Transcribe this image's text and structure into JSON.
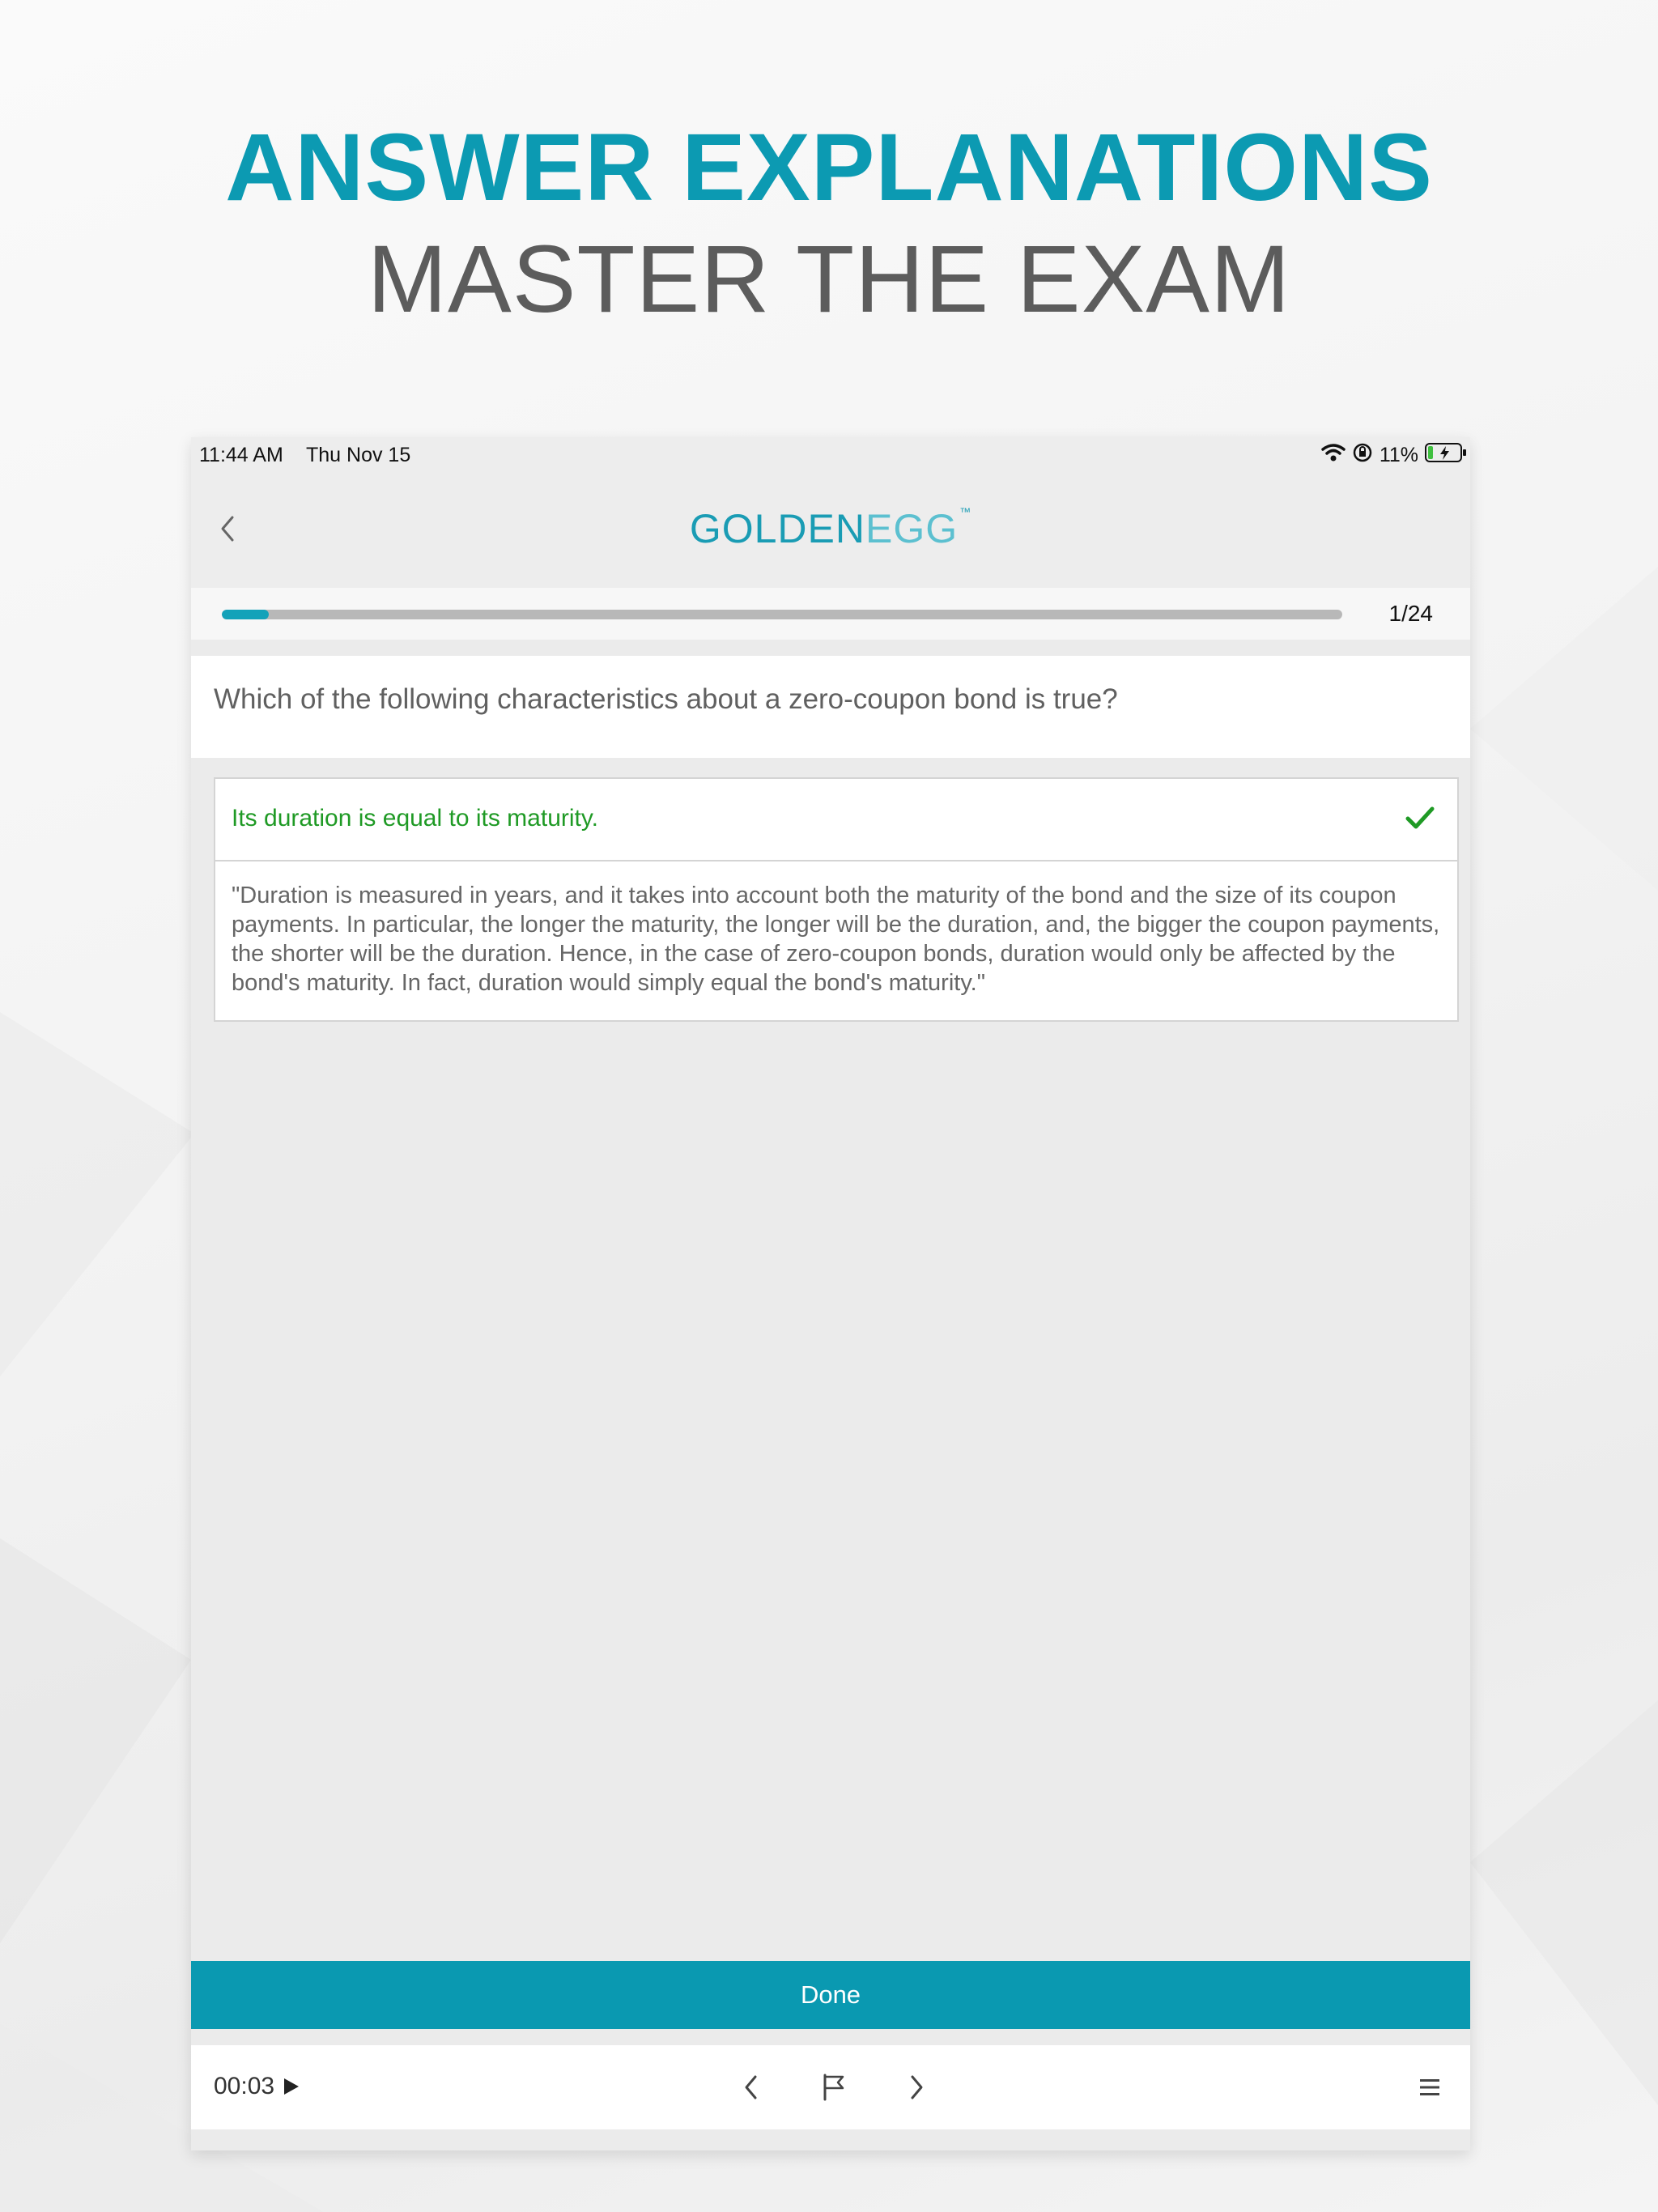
{
  "promo": {
    "headline": "ANSWER EXPLANATIONS",
    "subheadline": "MASTER THE EXAM"
  },
  "status_bar": {
    "time": "11:44 AM",
    "date": "Thu Nov 15",
    "battery_percent": "11%",
    "icons": [
      "wifi-icon",
      "orientation-lock-icon",
      "battery-charging-icon"
    ]
  },
  "nav": {
    "back_icon": "chevron-left-icon",
    "logo_bold": "GOLDEN",
    "logo_light": "EGG",
    "logo_mark": "™"
  },
  "progress": {
    "label": "1/24",
    "current": 1,
    "total": 24,
    "fraction": 0.0417,
    "color": "#13a2b9"
  },
  "question": {
    "text": "Which of the following characteristics about a zero-coupon bond is true?"
  },
  "answer": {
    "text": "Its duration is equal to its maturity.",
    "correct": true,
    "icon": "checkmark-icon",
    "color": "#1f9a25",
    "explanation": "\"Duration is measured in years, and it takes into account both the maturity of the bond and the size of its coupon payments. In particular, the longer the maturity, the longer will be the duration, and, the bigger the coupon payments, the shorter will be the duration. Hence, in the case of zero-coupon bonds, duration would only be affected by the bond's maturity. In fact, duration would simply equal the bond's maturity.\""
  },
  "done_button": {
    "label": "Done",
    "color": "#0a99b1"
  },
  "bottom_bar": {
    "timer": "00:03",
    "icons": [
      "play-icon",
      "previous-question-icon",
      "flag-icon",
      "next-question-icon",
      "menu-icon"
    ]
  }
}
